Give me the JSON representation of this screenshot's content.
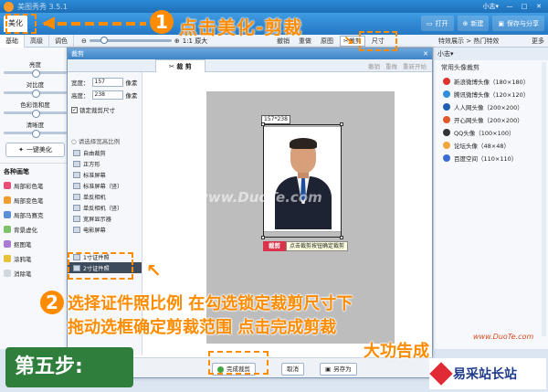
{
  "app": {
    "title": "美图秀秀 3.5.1",
    "user": "小志▾",
    "window_buttons": [
      "—",
      "□",
      "✕"
    ]
  },
  "menubar": {
    "active_tab": "美化",
    "actions": [
      "打开",
      "新建",
      "保存与分享"
    ]
  },
  "subtabs": {
    "items": [
      "基础",
      "高级",
      "调色"
    ],
    "zoom_label": "1:1 原大"
  },
  "edit_tools": {
    "undo": "撤销",
    "redo": "重做",
    "restore": "原图",
    "crop": "裁剪",
    "size": "尺寸"
  },
  "hot_effects": "特效展示 > 热门特效",
  "more": "更多",
  "left_panel": {
    "adjustments": [
      "亮度",
      "对比度",
      "色彩饱和度",
      "清晰度"
    ],
    "one_key": "一键美化",
    "brush_title": "各种画笔",
    "brushes": [
      "局部彩色笔",
      "局部变色笔",
      "局部马赛克",
      "背景虚化",
      "抠图笔",
      "涂鸦笔",
      "消除笔"
    ]
  },
  "right_panel": {
    "head": "小志▾",
    "section": "常用头像裁剪",
    "avatar_sizes": [
      "新浪微博头像（180×180）",
      "腾讯微博头像（120×120）",
      "人人网头像（200×200）",
      "开心网头像（200×200）",
      "QQ头像（100×100）",
      "论坛头像（48×48）",
      "百度空间（110×110）"
    ]
  },
  "dialog": {
    "title": "裁剪",
    "close": "✕",
    "tab": "裁 剪",
    "tools": [
      "撤销",
      "重做",
      "重新开始"
    ],
    "width_label": "宽度：",
    "width_value": "157",
    "height_label": "高度：",
    "height_value": "238",
    "unit": "像素",
    "lock_label": "锁定裁剪尺寸",
    "lock_checked": "✓",
    "ratio_title": "○ 请选择宽高比例",
    "ratios": [
      "自由裁剪",
      "正方形",
      "标准屏幕",
      "标准屏幕（竖）",
      "单反相机",
      "单反相机（竖）",
      "宽屏显示器",
      "电影屏幕"
    ],
    "id_ratios": [
      "1寸证件照",
      "2寸证件照"
    ],
    "size_tag": "157*238",
    "crop_button": "裁剪",
    "crop_hint": "点击裁剪按钮确定裁剪",
    "footer_buttons": [
      "完成裁剪",
      "取消",
      "另存为"
    ]
  },
  "annotations": {
    "step1_number": "1",
    "step1_text": "点击美化-剪裁",
    "step2_number": "2",
    "step2_line1": "选择证件照比例 在勾选锁定裁剪尺寸下",
    "step2_line2": "拖动选框确定剪裁范围 点击完成剪裁",
    "step2_line3": "大功告成",
    "step5": "第五步:"
  },
  "watermark": "www.DuoTe.com",
  "brand": {
    "name": "易采站长站",
    "domain": "www.DuoTe.com"
  },
  "colors": {
    "accent": "#ff8c00",
    "titlebar": "#2478c4",
    "crop_button": "#d9344b",
    "step_bg": "#2f7e3b"
  }
}
